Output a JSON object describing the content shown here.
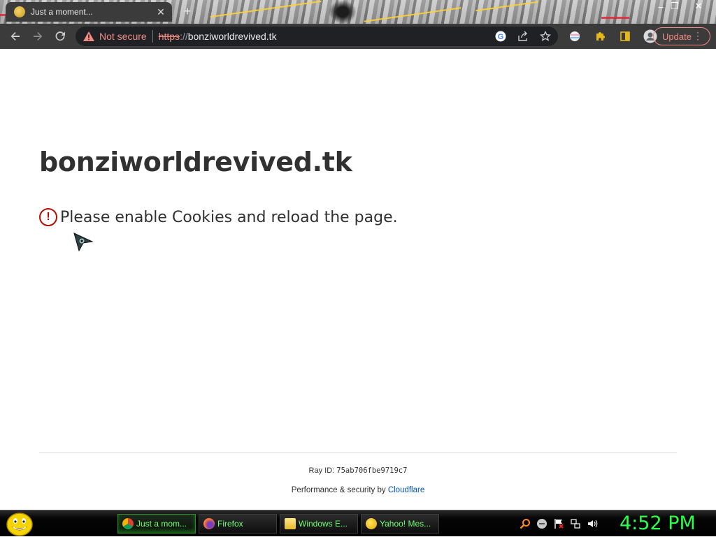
{
  "browser": {
    "tab": {
      "title": "Just a moment...",
      "close": "✕"
    },
    "new_tab": "+",
    "window_controls": {
      "minimize": "–",
      "restore": "❐",
      "close": "✕"
    },
    "address_bar": {
      "security_label": "Not secure",
      "scheme": "https",
      "separator": "://",
      "host": "bonziworldrevived.tk"
    },
    "update_label": "Update",
    "icons": {
      "back": "back-arrow-icon",
      "forward": "forward-arrow-icon",
      "reload": "reload-icon",
      "google": "google-icon",
      "share": "share-icon",
      "bookmark": "star-icon",
      "extension_flag": "flag-extension-icon",
      "extensions": "puzzle-icon",
      "sidebar": "side-panel-icon",
      "profile": "profile-icon",
      "menu": "more-vert-icon"
    }
  },
  "page": {
    "site_title": "bonziworldrevived.tk",
    "error_glyph": "!",
    "error_message": "Please enable Cookies and reload the page.",
    "ray_label": "Ray ID: ",
    "ray_id": "75ab706fbe9719c7",
    "perf_prefix": "Performance & security by ",
    "perf_link": "Cloudflare"
  },
  "taskbar": {
    "tasks": [
      {
        "label": "Just a mom...",
        "icon": "chrome-icon",
        "active": true
      },
      {
        "label": "Firefox",
        "icon": "firefox-icon",
        "active": false
      },
      {
        "label": "Windows E...",
        "icon": "folder-icon",
        "active": false
      },
      {
        "label": "Yahoo! Mes...",
        "icon": "yahoo-messenger-icon",
        "active": false
      }
    ],
    "tray_icons": [
      "search-icon",
      "messenger-status-icon",
      "flag-icon",
      "network-icon",
      "volume-icon"
    ],
    "clock": "4:52 PM"
  },
  "colors": {
    "browser_chrome": "#3b3b3b",
    "omnibox": "#202124",
    "not_secure": "#f28b82",
    "error_red": "#b20f03",
    "link_blue": "#0051c3",
    "taskbar_text": "#6dff6d",
    "clock_green": "#2bff4a"
  }
}
